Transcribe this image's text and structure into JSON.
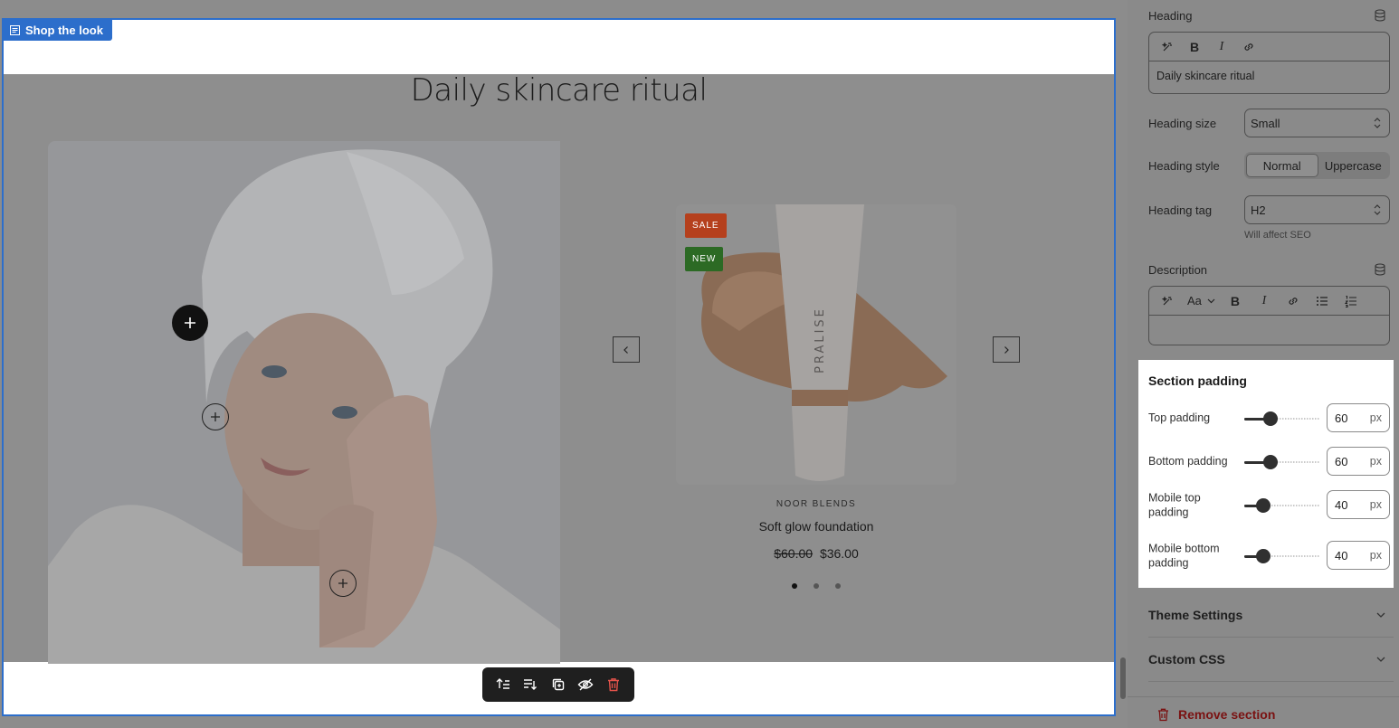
{
  "section": {
    "label": "Shop the look",
    "heading": "Daily skincare ritual"
  },
  "product": {
    "badges": {
      "sale": "SALE",
      "new": "NEW"
    },
    "brand_on_tube": "PRALISE",
    "vendor": "NOOR BLENDS",
    "title": "Soft glow foundation",
    "compare_price": "$60.00",
    "price": "$36.00",
    "carousel_dots": 3,
    "active_dot": 0
  },
  "toolbar": {
    "buttons": [
      "move-up",
      "move-down",
      "duplicate",
      "hide",
      "delete"
    ]
  },
  "settings": {
    "heading": {
      "label": "Heading",
      "value": "Daily skincare ritual"
    },
    "heading_size": {
      "label": "Heading size",
      "value": "Small"
    },
    "heading_style": {
      "label": "Heading style",
      "options": [
        "Normal",
        "Uppercase"
      ],
      "selected": "Normal"
    },
    "heading_tag": {
      "label": "Heading tag",
      "value": "H2",
      "help": "Will affect SEO"
    },
    "description": {
      "label": "Description",
      "value": "",
      "format_label": "Aa"
    },
    "section_padding": {
      "title": "Section padding",
      "rows": [
        {
          "label": "Top padding",
          "value": "60",
          "unit": "px",
          "percent": 0.35
        },
        {
          "label": "Bottom padding",
          "value": "60",
          "unit": "px",
          "percent": 0.35
        },
        {
          "label": "Mobile top padding",
          "value": "40",
          "unit": "px",
          "percent": 0.25
        },
        {
          "label": "Mobile bottom padding",
          "value": "40",
          "unit": "px",
          "percent": 0.25
        }
      ]
    },
    "theme_settings": "Theme Settings",
    "custom_css": "Custom CSS",
    "remove_section": "Remove section"
  },
  "colors": {
    "accent": "#2c6ecb",
    "sale_badge": "#b5401d",
    "new_badge": "#2c6a24",
    "danger": "#7a1212"
  }
}
